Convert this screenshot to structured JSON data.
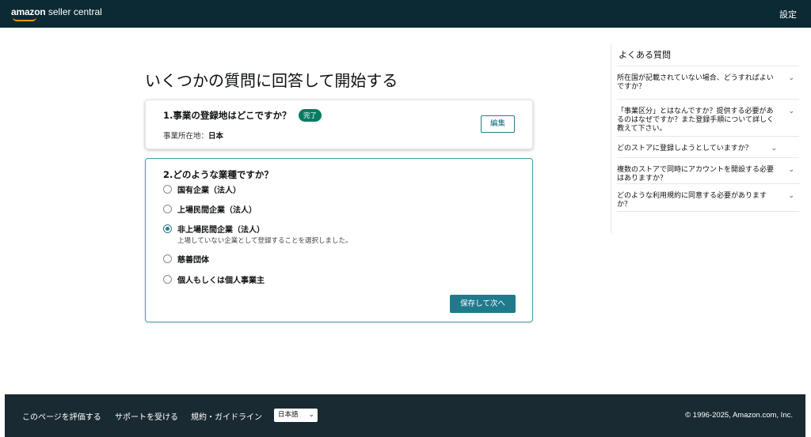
{
  "header": {
    "logo_brand": "amazon",
    "logo_rest": " seller central",
    "settings_label": "設定"
  },
  "page": {
    "title": "いくつかの質問に回答して開始する"
  },
  "question1": {
    "title": "1.事業の登録地はどこですか？",
    "badge": "完了",
    "location_label": "事業所在地：",
    "location_value": "日本",
    "edit_label": "編集"
  },
  "question2": {
    "title": "2.どのような業種ですか？",
    "options": [
      {
        "label": "国有企業（法人）",
        "selected": false
      },
      {
        "label": "上場民間企業（法人）",
        "selected": false
      },
      {
        "label": "非上場民間企業（法人）",
        "selected": true
      },
      {
        "label": "慈善団体",
        "selected": false
      },
      {
        "label": "個人もしくは個人事業主",
        "selected": false
      }
    ],
    "selected_note": "上場していない企業として登録することを選択しました。",
    "save_label": "保存して次へ"
  },
  "faq": {
    "title": "よくある質問",
    "items": [
      {
        "question": "所在国が記載されていない場合、どうすればよいですか？"
      },
      {
        "question": "「事業区分」とはなんですか？提供する必要があるのはなぜですか？また登録手順について詳しく教えて下さい。"
      },
      {
        "question": "どのストアに登録しようとしていますか？"
      },
      {
        "question": "複数のストアで同時にアカウントを開設する必要はありますか？"
      },
      {
        "question": "どのような利用規約に同意する必要がありますか？"
      }
    ]
  },
  "footer": {
    "links": [
      "このページを評価する",
      "サポートを受ける",
      "規約・ガイドライン"
    ],
    "language": "日本語",
    "copyright": "© 1996-2025, Amazon.com, Inc."
  },
  "colors": {
    "header_bg": "#0b2a33",
    "footer_bg": "#1a2a33",
    "accent_teal": "#1f7a8c",
    "badge_green": "#067d62",
    "logo_smile": "#ff9900"
  },
  "icons": {
    "faq_expand": "chevron-down-icon",
    "radio": "radio-button-icon"
  }
}
